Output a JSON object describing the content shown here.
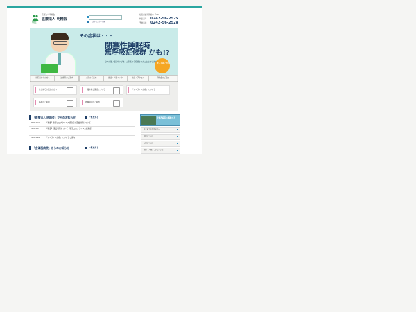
{
  "header": {
    "logo_sub": "医療法人 明精会",
    "logo_name": "医療法人 明精会",
    "logo_badge": "明精会",
    "search_note": "文字の大小 / 印刷",
    "address": "福島県会津若松市 〒965",
    "phones": [
      {
        "label": "代表番号",
        "number": "0242-56-2525"
      },
      {
        "label": "予約専用",
        "number": "0242-56-2528"
      }
    ]
  },
  "hero": {
    "pre": "その症状は・・・",
    "title_line1": "閉塞性睡眠時",
    "title_line2": "無呼吸症候群 かも!?",
    "desc": "日中の強い眠気やいびき、ご家族から指摘されたことはありませんか。",
    "cta": "詳しくは こちら"
  },
  "nav": {
    "items": [
      "当院初めての方へ",
      "診療科のご案内",
      "入院のご案内",
      "健診・人間ドック",
      "交通・アクセス",
      "明精会のご案内"
    ]
  },
  "cards": [
    {
      "label": "はじめての受診の方へ",
      "icon": "shield-icon"
    },
    {
      "label": "一般外来と受診について",
      "icon": "document-icon"
    },
    {
      "label": "「オンライン診療」について",
      "icon": "document-icon"
    },
    {
      "label": "病棟のご案内",
      "icon": "building-icon"
    },
    {
      "label": "各種検診のご案内",
      "icon": "stethoscope-icon"
    }
  ],
  "news": {
    "title": "「医療法人 明精会」からのお知らせ",
    "more": "一覧を見る",
    "items": [
      {
        "date": "2021.4.21",
        "text": "【重要】新型コロナウイルス感染症の面会制限について"
      },
      {
        "date": "2021.1.8",
        "text": "【重要】 面会制限について（新型コロナウイルス感染症）"
      },
      {
        "date": "2021.1.26",
        "text": "「オンライン診療」について ご案内"
      }
    ]
  },
  "news2": {
    "title": "「会津西病院」からのお知らせ",
    "more": "一覧を見る"
  },
  "sidebar": {
    "banner": "会津西病院 へ移動する",
    "items": [
      "はじめての受診の方へ",
      "病院について",
      "入院について",
      "健診・人間ドックについて"
    ]
  }
}
